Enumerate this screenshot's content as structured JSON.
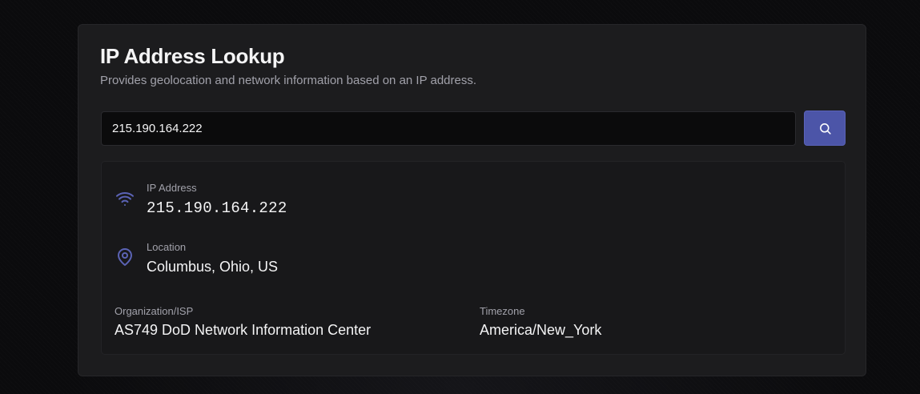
{
  "header": {
    "title": "IP Address Lookup",
    "subtitle": "Provides geolocation and network information based on an IP address."
  },
  "search": {
    "value": "215.190.164.222",
    "button_icon": "search-icon"
  },
  "results": {
    "ip": {
      "icon": "wifi-icon",
      "label": "IP Address",
      "value": "215.190.164.222"
    },
    "location": {
      "icon": "map-pin-icon",
      "label": "Location",
      "value": "Columbus, Ohio, US"
    },
    "organization": {
      "label": "Organization/ISP",
      "value": "AS749 DoD Network Information Center"
    },
    "timezone": {
      "label": "Timezone",
      "value": "America/New_York"
    }
  },
  "colors": {
    "accent": "#4c55a8",
    "icon": "#5b63b5",
    "card": "#1c1c1e",
    "text": "#f4f4f5",
    "muted": "#a1a1aa"
  }
}
